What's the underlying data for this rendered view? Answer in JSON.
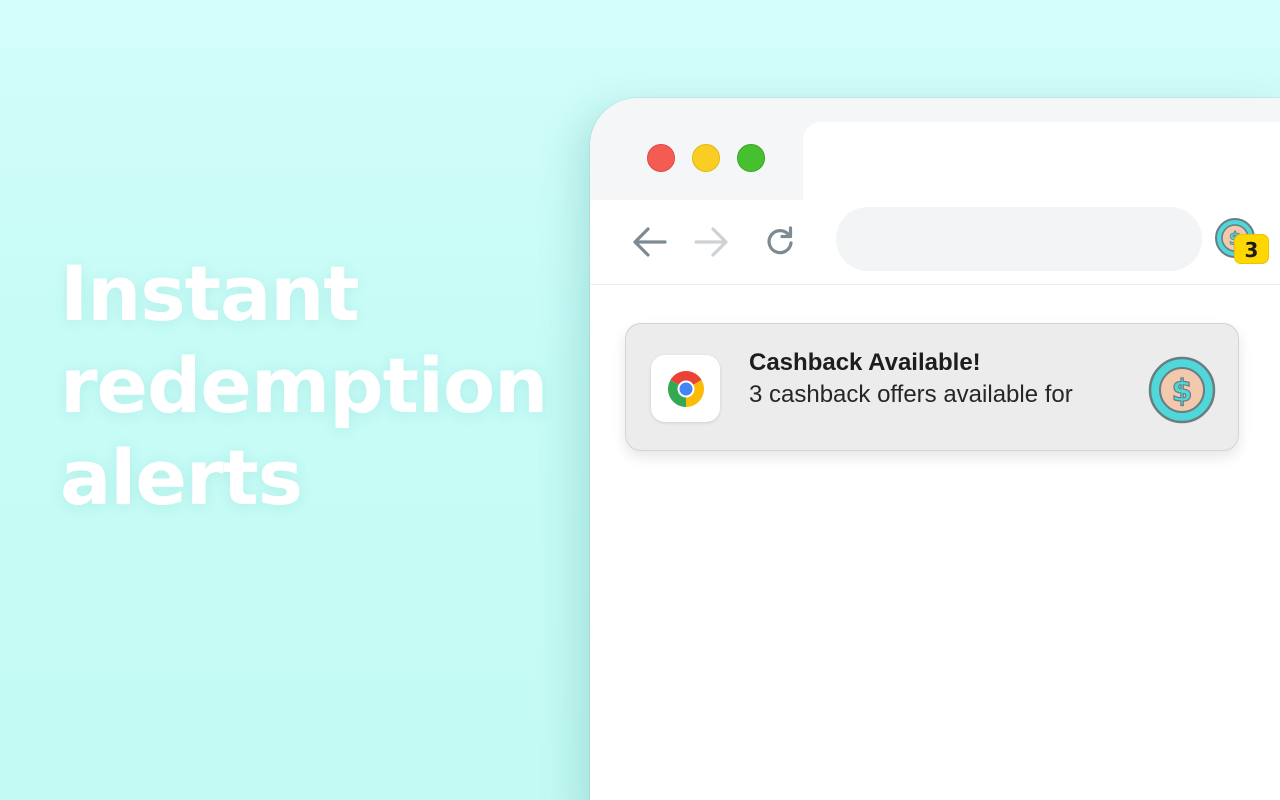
{
  "headline": {
    "lines": [
      "Instant",
      "redemption",
      "alerts"
    ]
  },
  "browser": {
    "traffic_lights": [
      "close",
      "minimize",
      "maximize"
    ],
    "toolbar": {
      "back_icon": "arrow-left-icon",
      "forward_icon": "arrow-right-icon",
      "reload_icon": "reload-icon",
      "address_value": "",
      "extension_badge": "3"
    }
  },
  "notification": {
    "app_icon": "chrome-icon",
    "title": "Cashback Available!",
    "body": "3 cashback offers available for",
    "image_icon": "dollar-coin-icon"
  },
  "colors": {
    "background": "#c9fbf6",
    "headline_text": "#ffffff",
    "traffic_red": "#f45b53",
    "traffic_yellow": "#f9cd24",
    "traffic_green": "#47c02f",
    "badge_yellow": "#ffd700",
    "coin_teal": "#4fd7d9",
    "notification_bg": "#ececec"
  }
}
